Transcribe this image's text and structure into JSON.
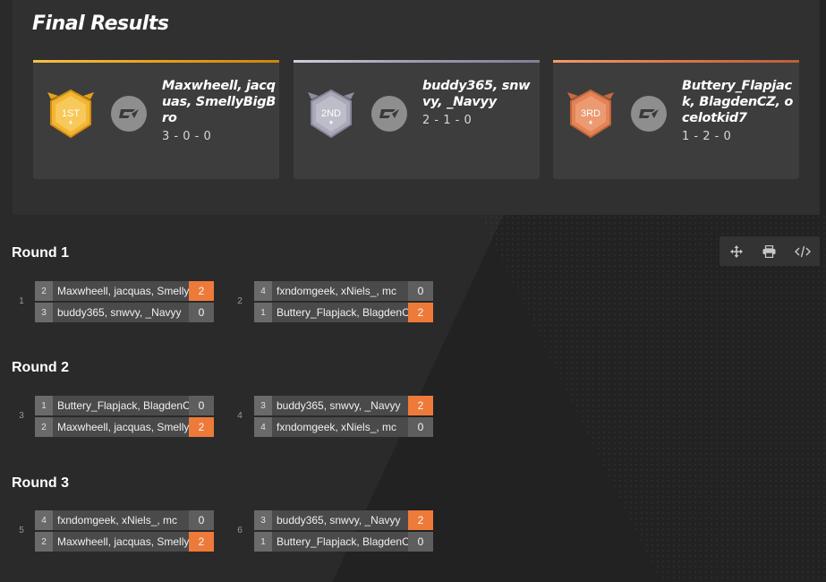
{
  "results": {
    "title": "Final Results",
    "placings": [
      {
        "medal": "1ST",
        "names": "Maxwheell, jacquas, SmellyBigBro",
        "record": "3 - 0 - 0"
      },
      {
        "medal": "2ND",
        "names": "buddy365, snwvy, _Navyy",
        "record": "2 - 1 - 0"
      },
      {
        "medal": "3RD",
        "names": "Buttery_Flapjack, BlagdenCZ, ocelotkid7",
        "record": "1 - 2 - 0"
      }
    ]
  },
  "colors": {
    "gold": "#f0b429",
    "silver": "#a8a8b8",
    "bronze": "#e07d4f",
    "win": "#ee7a3a"
  },
  "toolbar": {
    "icons": [
      "move-icon",
      "print-icon",
      "embed-code-icon"
    ]
  },
  "rounds": [
    {
      "title": "Round 1",
      "matches": [
        {
          "number": "1",
          "teams": [
            {
              "seed": "2",
              "name": "Maxwheell, jacquas, SmellyBigBro",
              "score": "2",
              "win": true
            },
            {
              "seed": "3",
              "name": "buddy365, snwvy, _Navyy",
              "score": "0",
              "win": false
            }
          ]
        },
        {
          "number": "2",
          "teams": [
            {
              "seed": "4",
              "name": "fxndomgeek, xNiels_, mc",
              "score": "0",
              "win": false
            },
            {
              "seed": "1",
              "name": "Buttery_Flapjack, BlagdenCZ",
              "score": "2",
              "win": true
            }
          ]
        }
      ]
    },
    {
      "title": "Round 2",
      "matches": [
        {
          "number": "3",
          "teams": [
            {
              "seed": "1",
              "name": "Buttery_Flapjack, BlagdenCZ",
              "score": "0",
              "win": false
            },
            {
              "seed": "2",
              "name": "Maxwheell, jacquas, SmellyBigBro",
              "score": "2",
              "win": true
            }
          ]
        },
        {
          "number": "4",
          "teams": [
            {
              "seed": "3",
              "name": "buddy365, snwvy, _Navyy",
              "score": "2",
              "win": true
            },
            {
              "seed": "4",
              "name": "fxndomgeek, xNiels_, mc",
              "score": "0",
              "win": false
            }
          ]
        }
      ]
    },
    {
      "title": "Round 3",
      "matches": [
        {
          "number": "5",
          "teams": [
            {
              "seed": "4",
              "name": "fxndomgeek, xNiels_, mc",
              "score": "0",
              "win": false
            },
            {
              "seed": "2",
              "name": "Maxwheell, jacquas, SmellyBigBro",
              "score": "2",
              "win": true
            }
          ]
        },
        {
          "number": "6",
          "teams": [
            {
              "seed": "3",
              "name": "buddy365, snwvy, _Navyy",
              "score": "2",
              "win": true
            },
            {
              "seed": "1",
              "name": "Buttery_Flapjack, BlagdenCZ",
              "score": "0",
              "win": false
            }
          ]
        }
      ]
    }
  ]
}
